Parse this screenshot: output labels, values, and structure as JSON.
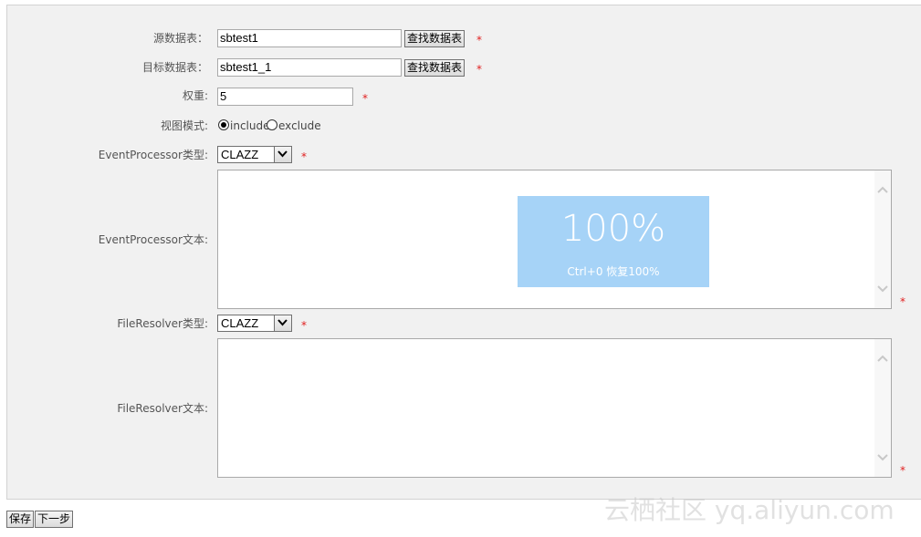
{
  "form": {
    "source_table": {
      "label": "源数据表：",
      "value": "sbtest1",
      "button": "查找数据表",
      "required": "*"
    },
    "target_table": {
      "label": "目标数据表：",
      "value": "sbtest1_1",
      "button": "查找数据表",
      "required": "*"
    },
    "weight": {
      "label": "权重:",
      "value": "5",
      "required": "*"
    },
    "view_mode": {
      "label": "视图模式:",
      "options": [
        "include",
        "exclude"
      ],
      "selected": "include"
    },
    "event_processor_type": {
      "label": "EventProcessor类型:",
      "value": "CLAZZ",
      "required": "*"
    },
    "event_processor_text": {
      "label": "EventProcessor文本:",
      "required": "*"
    },
    "file_resolver_type": {
      "label": "FileResolver类型:",
      "value": "CLAZZ",
      "required": "*"
    },
    "file_resolver_text": {
      "label": "FileResolver文本:",
      "required": "*"
    }
  },
  "zoom_overlay": {
    "level": "100%",
    "hint": "Ctrl+0 恢复100%"
  },
  "actions": {
    "save": "保存",
    "next": "下一步"
  },
  "watermark": "云栖社区 yq.aliyun.com",
  "colors": {
    "required": "#e02020",
    "panel_bg": "#f1f1f1",
    "zoom_bg": "#a6d3f7"
  }
}
